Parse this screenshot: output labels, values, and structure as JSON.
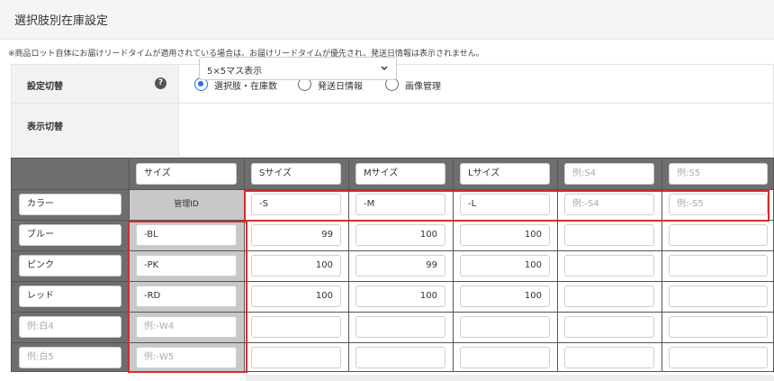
{
  "page": {
    "title": "選択肢別在庫設定"
  },
  "notice": "※商品ロット自体にお届けリードタイムが適用されている場合は、お届けリードタイムが優先され、発送日情報は表示されません。",
  "settings": {
    "mode_label": "設定切替",
    "help_icon": "question-circle-icon",
    "radios": [
      {
        "label": "選択肢・在庫数",
        "checked": true
      },
      {
        "label": "発送日情報",
        "checked": false
      },
      {
        "label": "画像管理",
        "checked": false
      }
    ],
    "display_label": "表示切替",
    "display_select": "5×5マス表示"
  },
  "grid": {
    "size_header": "サイズ",
    "color_header": "カラー",
    "mgmt_id": "管理ID",
    "sizes": [
      {
        "name": "Sサイズ",
        "id": "-S",
        "placeholder": false
      },
      {
        "name": "Mサイズ",
        "id": "-M",
        "placeholder": false
      },
      {
        "name": "Lサイズ",
        "id": "-L",
        "placeholder": false
      },
      {
        "name": "例:S4",
        "id": "例:-S4",
        "placeholder": true
      },
      {
        "name": "例:S5",
        "id": "例:-S5",
        "placeholder": true
      }
    ],
    "colors": [
      {
        "name": "ブルー",
        "id": "-BL",
        "placeholder": false,
        "stock": [
          "99",
          "100",
          "100",
          "",
          ""
        ]
      },
      {
        "name": "ピンク",
        "id": "-PK",
        "placeholder": false,
        "stock": [
          "100",
          "99",
          "100",
          "",
          ""
        ]
      },
      {
        "name": "レッド",
        "id": "-RD",
        "placeholder": false,
        "stock": [
          "100",
          "100",
          "100",
          "",
          ""
        ]
      },
      {
        "name": "例:白4",
        "id": "例:-W4",
        "placeholder": true,
        "stock": [
          "",
          "",
          "",
          "",
          ""
        ]
      },
      {
        "name": "例:白5",
        "id": "例:-W5",
        "placeholder": true,
        "stock": [
          "",
          "",
          "",
          "",
          ""
        ]
      }
    ]
  },
  "colors": {
    "accent": "#1a73e8",
    "highlight": "#d32f2f",
    "header_band": "#6e6e6e",
    "mgmt_col": "#c8c8c8"
  }
}
